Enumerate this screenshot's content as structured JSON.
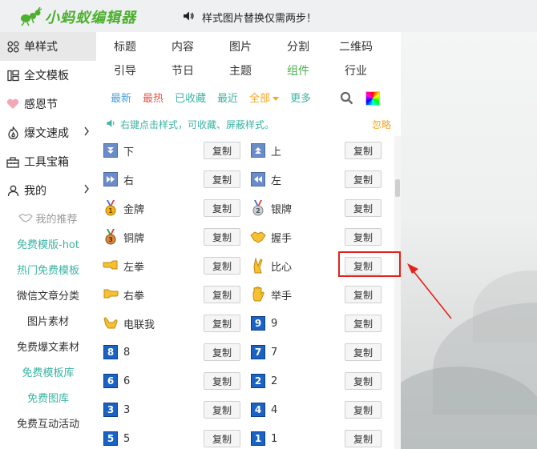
{
  "app": {
    "logo_text": "小蚂蚁编辑器",
    "notice": "样式图片替换仅需两步！"
  },
  "sidebar": {
    "items": [
      {
        "label": "单样式",
        "icon": "grid-icon",
        "active": true
      },
      {
        "label": "全文模板",
        "icon": "layout-icon"
      },
      {
        "label": "感恩节",
        "icon": "heart-icon"
      },
      {
        "label": "爆文速成",
        "icon": "fire-icon",
        "chevron": true
      },
      {
        "label": "工具宝箱",
        "icon": "toolbox-icon"
      },
      {
        "label": "我的",
        "icon": "user-icon",
        "chevron": true
      }
    ],
    "subs": [
      {
        "label": "我的推荐",
        "style": "gray"
      },
      {
        "label": "免费模版-hot",
        "style": "teal"
      },
      {
        "label": "热门免费模板",
        "style": "teal"
      },
      {
        "label": "微信文章分类",
        "style": "dark"
      },
      {
        "label": "图片素材",
        "style": "dark"
      },
      {
        "label": "免费爆文素材",
        "style": "dark"
      },
      {
        "label": "免费模板库",
        "style": "teal"
      },
      {
        "label": "免费图库",
        "style": "teal"
      },
      {
        "label": "免费互动活动",
        "style": "dark"
      }
    ]
  },
  "tabs": {
    "row1": [
      "标题",
      "内容",
      "图片",
      "分割",
      "二维码"
    ],
    "row2": [
      "引导",
      "节日",
      "主题",
      "组件",
      "行业"
    ]
  },
  "filters": {
    "newest": "最新",
    "hottest": "最热",
    "collected": "已收藏",
    "recent": "最近",
    "all": "全部",
    "more": "更多"
  },
  "hint": {
    "text": "右键点击样式，可收藏、屏蔽样式。",
    "ignore": "忽略"
  },
  "copy_label": "复制",
  "rows": [
    [
      {
        "label": "下",
        "icon": "down-arrow-box-icon"
      },
      {
        "label": "上",
        "icon": "up-arrow-box-icon"
      }
    ],
    [
      {
        "label": "右",
        "icon": "fast-forward-box-icon"
      },
      {
        "label": "左",
        "icon": "rewind-box-icon"
      }
    ],
    [
      {
        "label": "金牌",
        "icon": "gold-medal-icon"
      },
      {
        "label": "银牌",
        "icon": "silver-medal-icon"
      }
    ],
    [
      {
        "label": "铜牌",
        "icon": "bronze-medal-icon"
      },
      {
        "label": "握手",
        "icon": "handshake-icon"
      }
    ],
    [
      {
        "label": "左拳",
        "icon": "left-fist-icon"
      },
      {
        "label": "比心",
        "icon": "crossed-fingers-icon"
      }
    ],
    [
      {
        "label": "右拳",
        "icon": "right-fist-icon"
      },
      {
        "label": "举手",
        "icon": "raised-hand-icon"
      }
    ],
    [
      {
        "label": "电联我",
        "icon": "call-me-hand-icon"
      },
      {
        "label": "9",
        "icon": "keycap-9-icon",
        "num": "9"
      }
    ],
    [
      {
        "label": "8",
        "icon": "keycap-8-icon",
        "num": "8"
      },
      {
        "label": "7",
        "icon": "keycap-7-icon",
        "num": "7"
      }
    ],
    [
      {
        "label": "6",
        "icon": "keycap-6-icon",
        "num": "6"
      },
      {
        "label": "2",
        "icon": "keycap-2-icon",
        "num": "2"
      }
    ],
    [
      {
        "label": "3",
        "icon": "keycap-3-icon",
        "num": "3"
      },
      {
        "label": "4",
        "icon": "keycap-4-icon",
        "num": "4"
      }
    ],
    [
      {
        "label": "5",
        "icon": "keycap-5-icon",
        "num": "5"
      },
      {
        "label": "1",
        "icon": "keycap-1-icon",
        "num": "1"
      }
    ]
  ],
  "colors": {
    "teal": "#3cb3a4",
    "logo_green": "#4caf2d",
    "highlight_red": "#e2231a",
    "keycap_blue": "#1a63c4"
  }
}
